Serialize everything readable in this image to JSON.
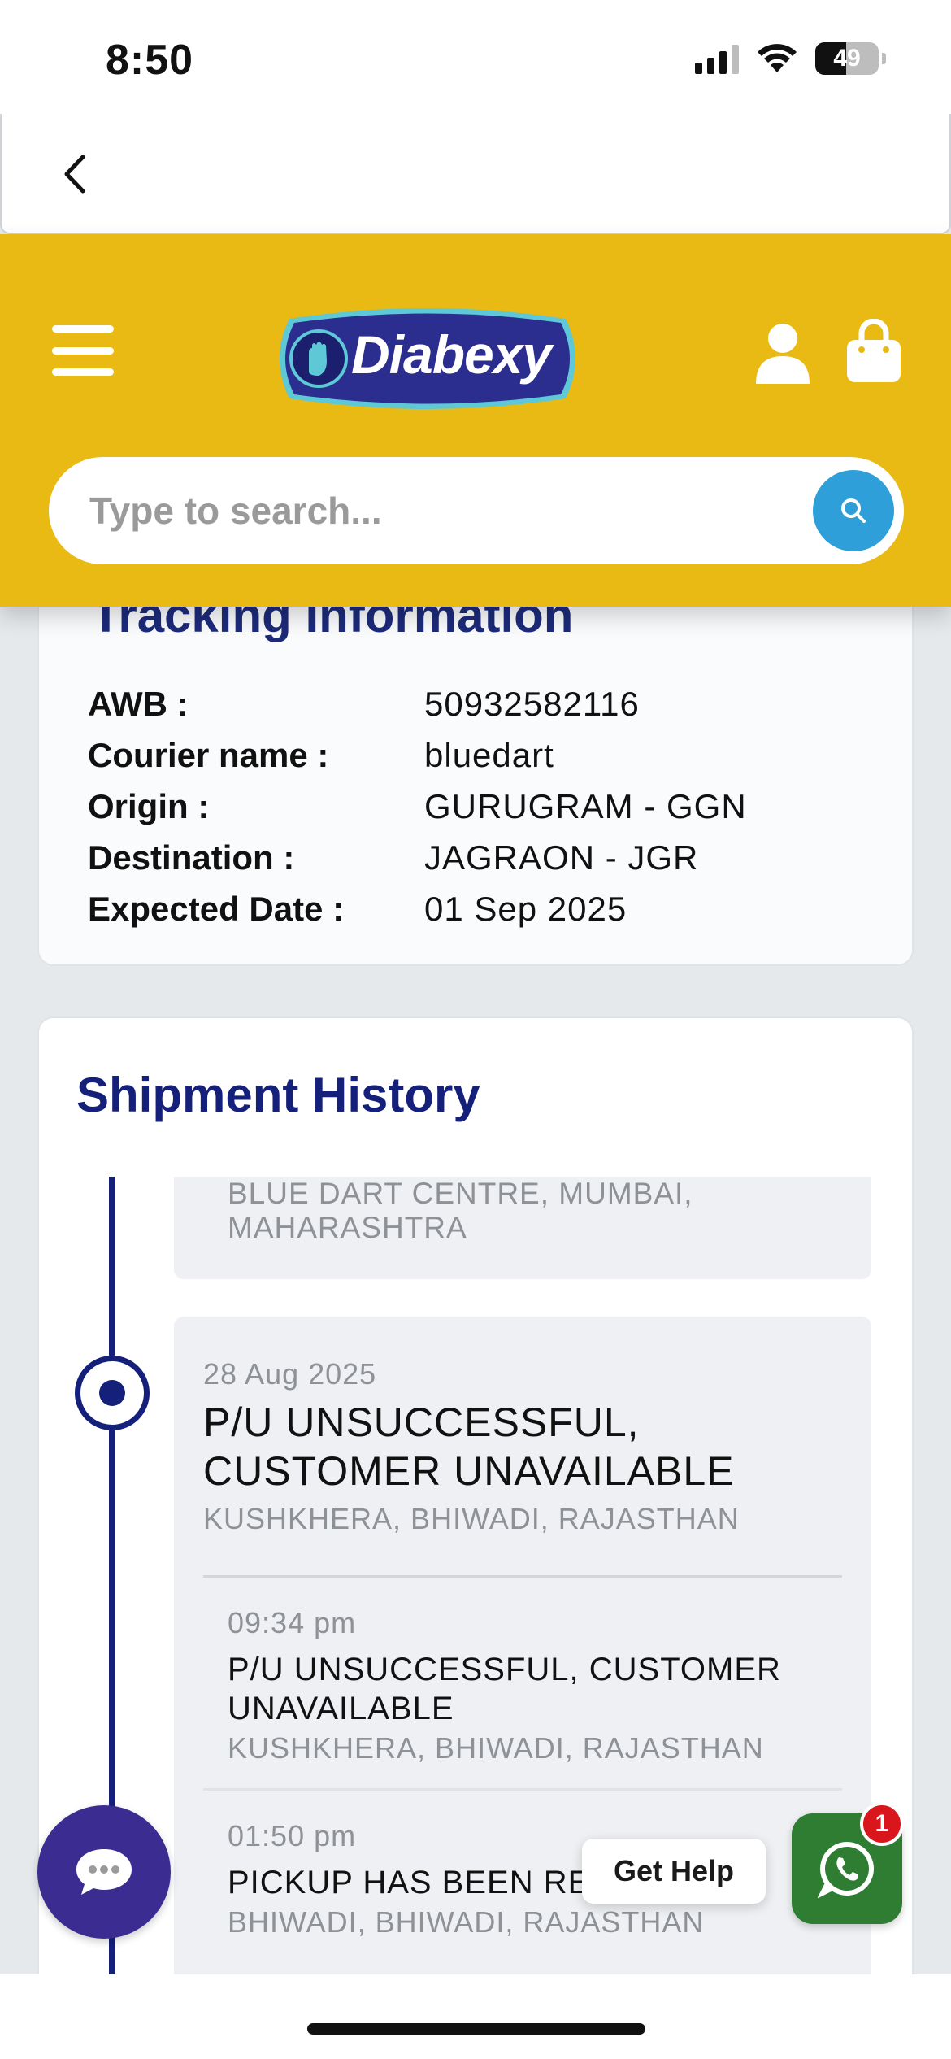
{
  "status_bar": {
    "time": "8:50",
    "battery": "49"
  },
  "header": {
    "logo_text": "Diabexy",
    "search": {
      "placeholder": "Type to search..."
    }
  },
  "tracking": {
    "title": "Tracking Information",
    "rows": [
      {
        "label": "AWB :",
        "value": "50932582116"
      },
      {
        "label": "Courier name :",
        "value": "bluedart"
      },
      {
        "label": "Origin :",
        "value": "GURUGRAM - GGN"
      },
      {
        "label": "Destination :",
        "value": "JAGRAON - JGR"
      },
      {
        "label": "Expected Date :",
        "value": "01 Sep 2025"
      }
    ]
  },
  "history": {
    "title": "Shipment History",
    "prev_entry": {
      "location": "BLUE DART CENTRE, MUMBAI, MAHARASHTRA"
    },
    "entry": {
      "date": "28 Aug 2025",
      "status": "P/U UNSUCCESSFUL, CUSTOMER UNAVAILABLE",
      "location": "KUSHKHERA, BHIWADI, RAJASTHAN",
      "events": [
        {
          "time": "09:34 pm",
          "status": "P/U UNSUCCESSFUL, CUSTOMER UNAVAILABLE",
          "location": "KUSHKHERA, BHIWADI, RAJASTHAN"
        },
        {
          "time": "01:50 pm",
          "status": "PICKUP HAS BEEN RE",
          "location": "BHIWADI, BHIWADI, RAJASTHAN"
        }
      ]
    }
  },
  "floating": {
    "get_help": "Get Help",
    "whatsapp_badge": "1"
  },
  "icons": {
    "back": "chevron-left-icon",
    "menu": "hamburger-menu-icon",
    "user": "user-icon",
    "cart": "shopping-bag-icon",
    "search": "search-icon",
    "chat": "chat-bubble-icon",
    "whatsapp": "whatsapp-icon"
  },
  "colors": {
    "header": "#e9b914",
    "brand_navy": "#14207a",
    "search_button": "#2e9fd8",
    "chat_fab": "#3b2c91",
    "whatsapp": "#2e7d32",
    "badge": "#d9161c"
  }
}
